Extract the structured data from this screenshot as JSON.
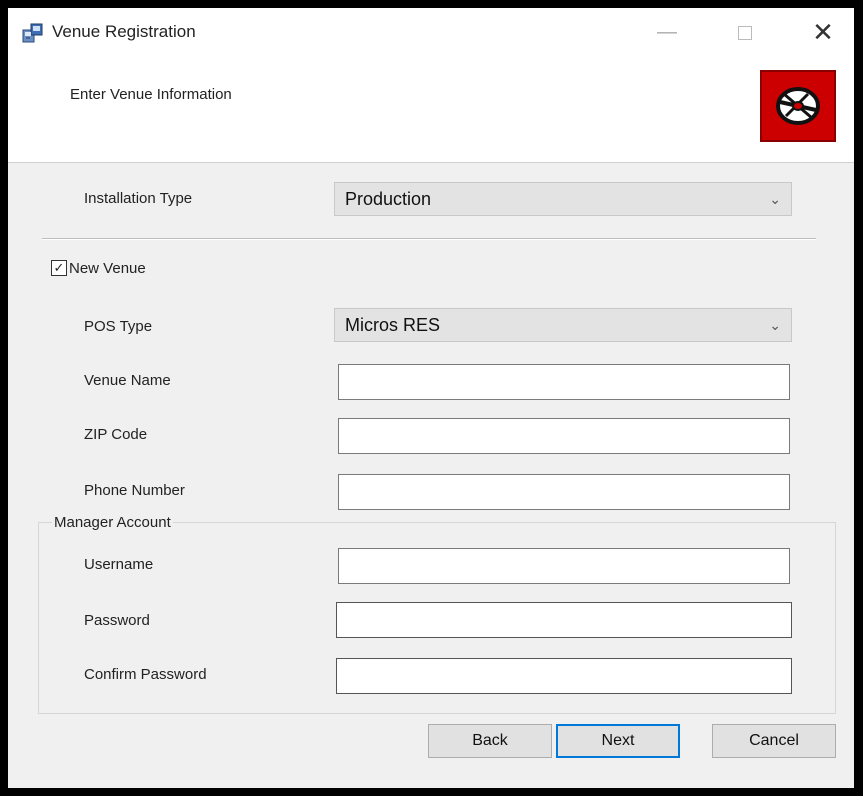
{
  "window": {
    "title": "Venue Registration",
    "minimize_glyph": "—",
    "close_glyph": "✕"
  },
  "header": {
    "subtitle": "Enter Venue Information",
    "logo_icon": "disc-icon",
    "logo_color": "#cc0000"
  },
  "form": {
    "installation_type": {
      "label": "Installation Type",
      "value": "Production"
    },
    "new_venue": {
      "label": "New Venue",
      "checked": true,
      "check_glyph": "✓"
    },
    "pos_type": {
      "label": "POS Type",
      "value": "Micros RES"
    },
    "venue_name": {
      "label": "Venue Name",
      "value": ""
    },
    "zip_code": {
      "label": "ZIP Code",
      "value": ""
    },
    "phone_number": {
      "label": "Phone Number",
      "value": ""
    },
    "manager_account": {
      "title": "Manager Account",
      "username": {
        "label": "Username",
        "value": ""
      },
      "password": {
        "label": "Password",
        "value": ""
      },
      "confirm_password": {
        "label": "Confirm Password",
        "value": ""
      }
    },
    "chevron_glyph": "⌄"
  },
  "buttons": {
    "back": "Back",
    "next": "Next",
    "cancel": "Cancel"
  },
  "colors": {
    "focus_accent": "#0078d7"
  }
}
